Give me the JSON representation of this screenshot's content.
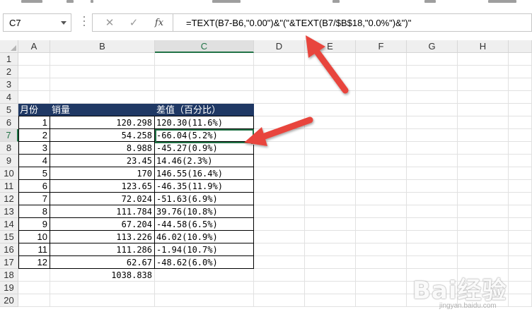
{
  "name_box": {
    "value": "C7"
  },
  "formula_bar": {
    "cancel_glyph": "✕",
    "enter_glyph": "✓",
    "fx_label": "fx",
    "formula": "=TEXT(B7-B6,\"0.00\")&\"(\"&TEXT(B7/$B$18,\"0.0%\")&\")\""
  },
  "columns": [
    "A",
    "B",
    "C",
    "D",
    "E",
    "F",
    "G",
    "H"
  ],
  "selected_column": "C",
  "rows": [
    "1",
    "2",
    "3",
    "4",
    "5",
    "6",
    "7",
    "8",
    "9",
    "10",
    "11",
    "12",
    "13",
    "14",
    "15",
    "16",
    "17",
    "18",
    "19",
    "20"
  ],
  "selected_row": "7",
  "table": {
    "header": {
      "a": "月份",
      "b": "销量",
      "c": "差值（百分比）"
    },
    "data": [
      {
        "a": "1",
        "b": "120.298",
        "c": "120.30(11.6%)"
      },
      {
        "a": "2",
        "b": "54.258",
        "c": "-66.04(5.2%)"
      },
      {
        "a": "3",
        "b": "8.988",
        "c": "-45.27(0.9%)"
      },
      {
        "a": "4",
        "b": "23.45",
        "c": "14.46(2.3%)"
      },
      {
        "a": "5",
        "b": "170",
        "c": "146.55(16.4%)"
      },
      {
        "a": "6",
        "b": "123.65",
        "c": "-46.35(11.9%)"
      },
      {
        "a": "7",
        "b": "72.024",
        "c": "-51.63(6.9%)"
      },
      {
        "a": "8",
        "b": "111.784",
        "c": "39.76(10.8%)"
      },
      {
        "a": "9",
        "b": "67.204",
        "c": "-44.58(6.5%)"
      },
      {
        "a": "10",
        "b": "113.226",
        "c": "46.02(10.9%)"
      },
      {
        "a": "11",
        "b": "111.286",
        "c": "-1.94(10.7%)"
      },
      {
        "a": "12",
        "b": "62.67",
        "c": "-48.62(6.0%)"
      }
    ],
    "total": {
      "b": "1038.838"
    }
  },
  "colors": {
    "header_fill": "#1f3864",
    "selection_green": "#217346",
    "arrow_red": "#e8453c"
  },
  "watermark": {
    "logo": "Bai经验",
    "url": "jingyan.baidu.com"
  }
}
